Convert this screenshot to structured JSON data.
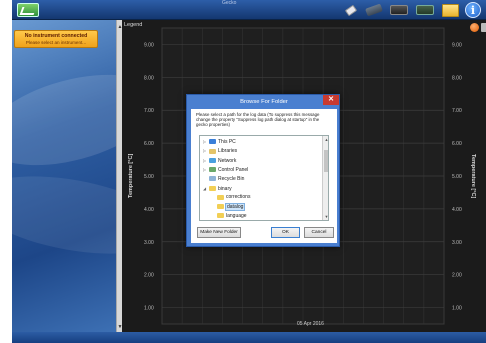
{
  "window": {
    "title": "Gecko"
  },
  "instrument": {
    "status": "No instrument connected",
    "hint": "Please select an instrument..."
  },
  "chart": {
    "legend": "Legend",
    "date_label": "05 Apr 2016"
  },
  "chart_data": {
    "type": "line",
    "ylabel": "Temperature [°C]",
    "ylabel_right": "Temperature [°C]",
    "y_ticks": [
      "9.00",
      "8.00",
      "7.00",
      "6.00",
      "5.00",
      "4.00",
      "3.00",
      "2.00",
      "1.00"
    ],
    "ylim": [
      0.5,
      9.5
    ],
    "grid": true,
    "series": []
  },
  "dialog": {
    "title": "Browse For Folder",
    "close": "✕",
    "message": "Please select a path for the log data (To suppress this message change the property \"Suppress log path dialog at startup\" in the gecko properties)",
    "tree": [
      {
        "label": "This PC",
        "icon": "pc",
        "indent": 0,
        "expander": "▷"
      },
      {
        "label": "Libraries",
        "icon": "lib",
        "indent": 0,
        "expander": "▷"
      },
      {
        "label": "Network",
        "icon": "net",
        "indent": 0,
        "expander": "▷"
      },
      {
        "label": "Control Panel",
        "icon": "cp",
        "indent": 0,
        "expander": "▷"
      },
      {
        "label": "Recycle Bin",
        "icon": "bin",
        "indent": 0,
        "expander": ""
      },
      {
        "label": "binary",
        "icon": "folder",
        "indent": 0,
        "expander": "◢"
      },
      {
        "label": "corrections",
        "icon": "folder",
        "indent": 1,
        "expander": ""
      },
      {
        "label": "datalog",
        "icon": "folder",
        "indent": 1,
        "expander": "",
        "selected": true
      },
      {
        "label": "language",
        "icon": "folder",
        "indent": 1,
        "expander": ""
      }
    ],
    "make_folder": "Make New Folder",
    "ok": "OK",
    "cancel": "Cancel"
  }
}
